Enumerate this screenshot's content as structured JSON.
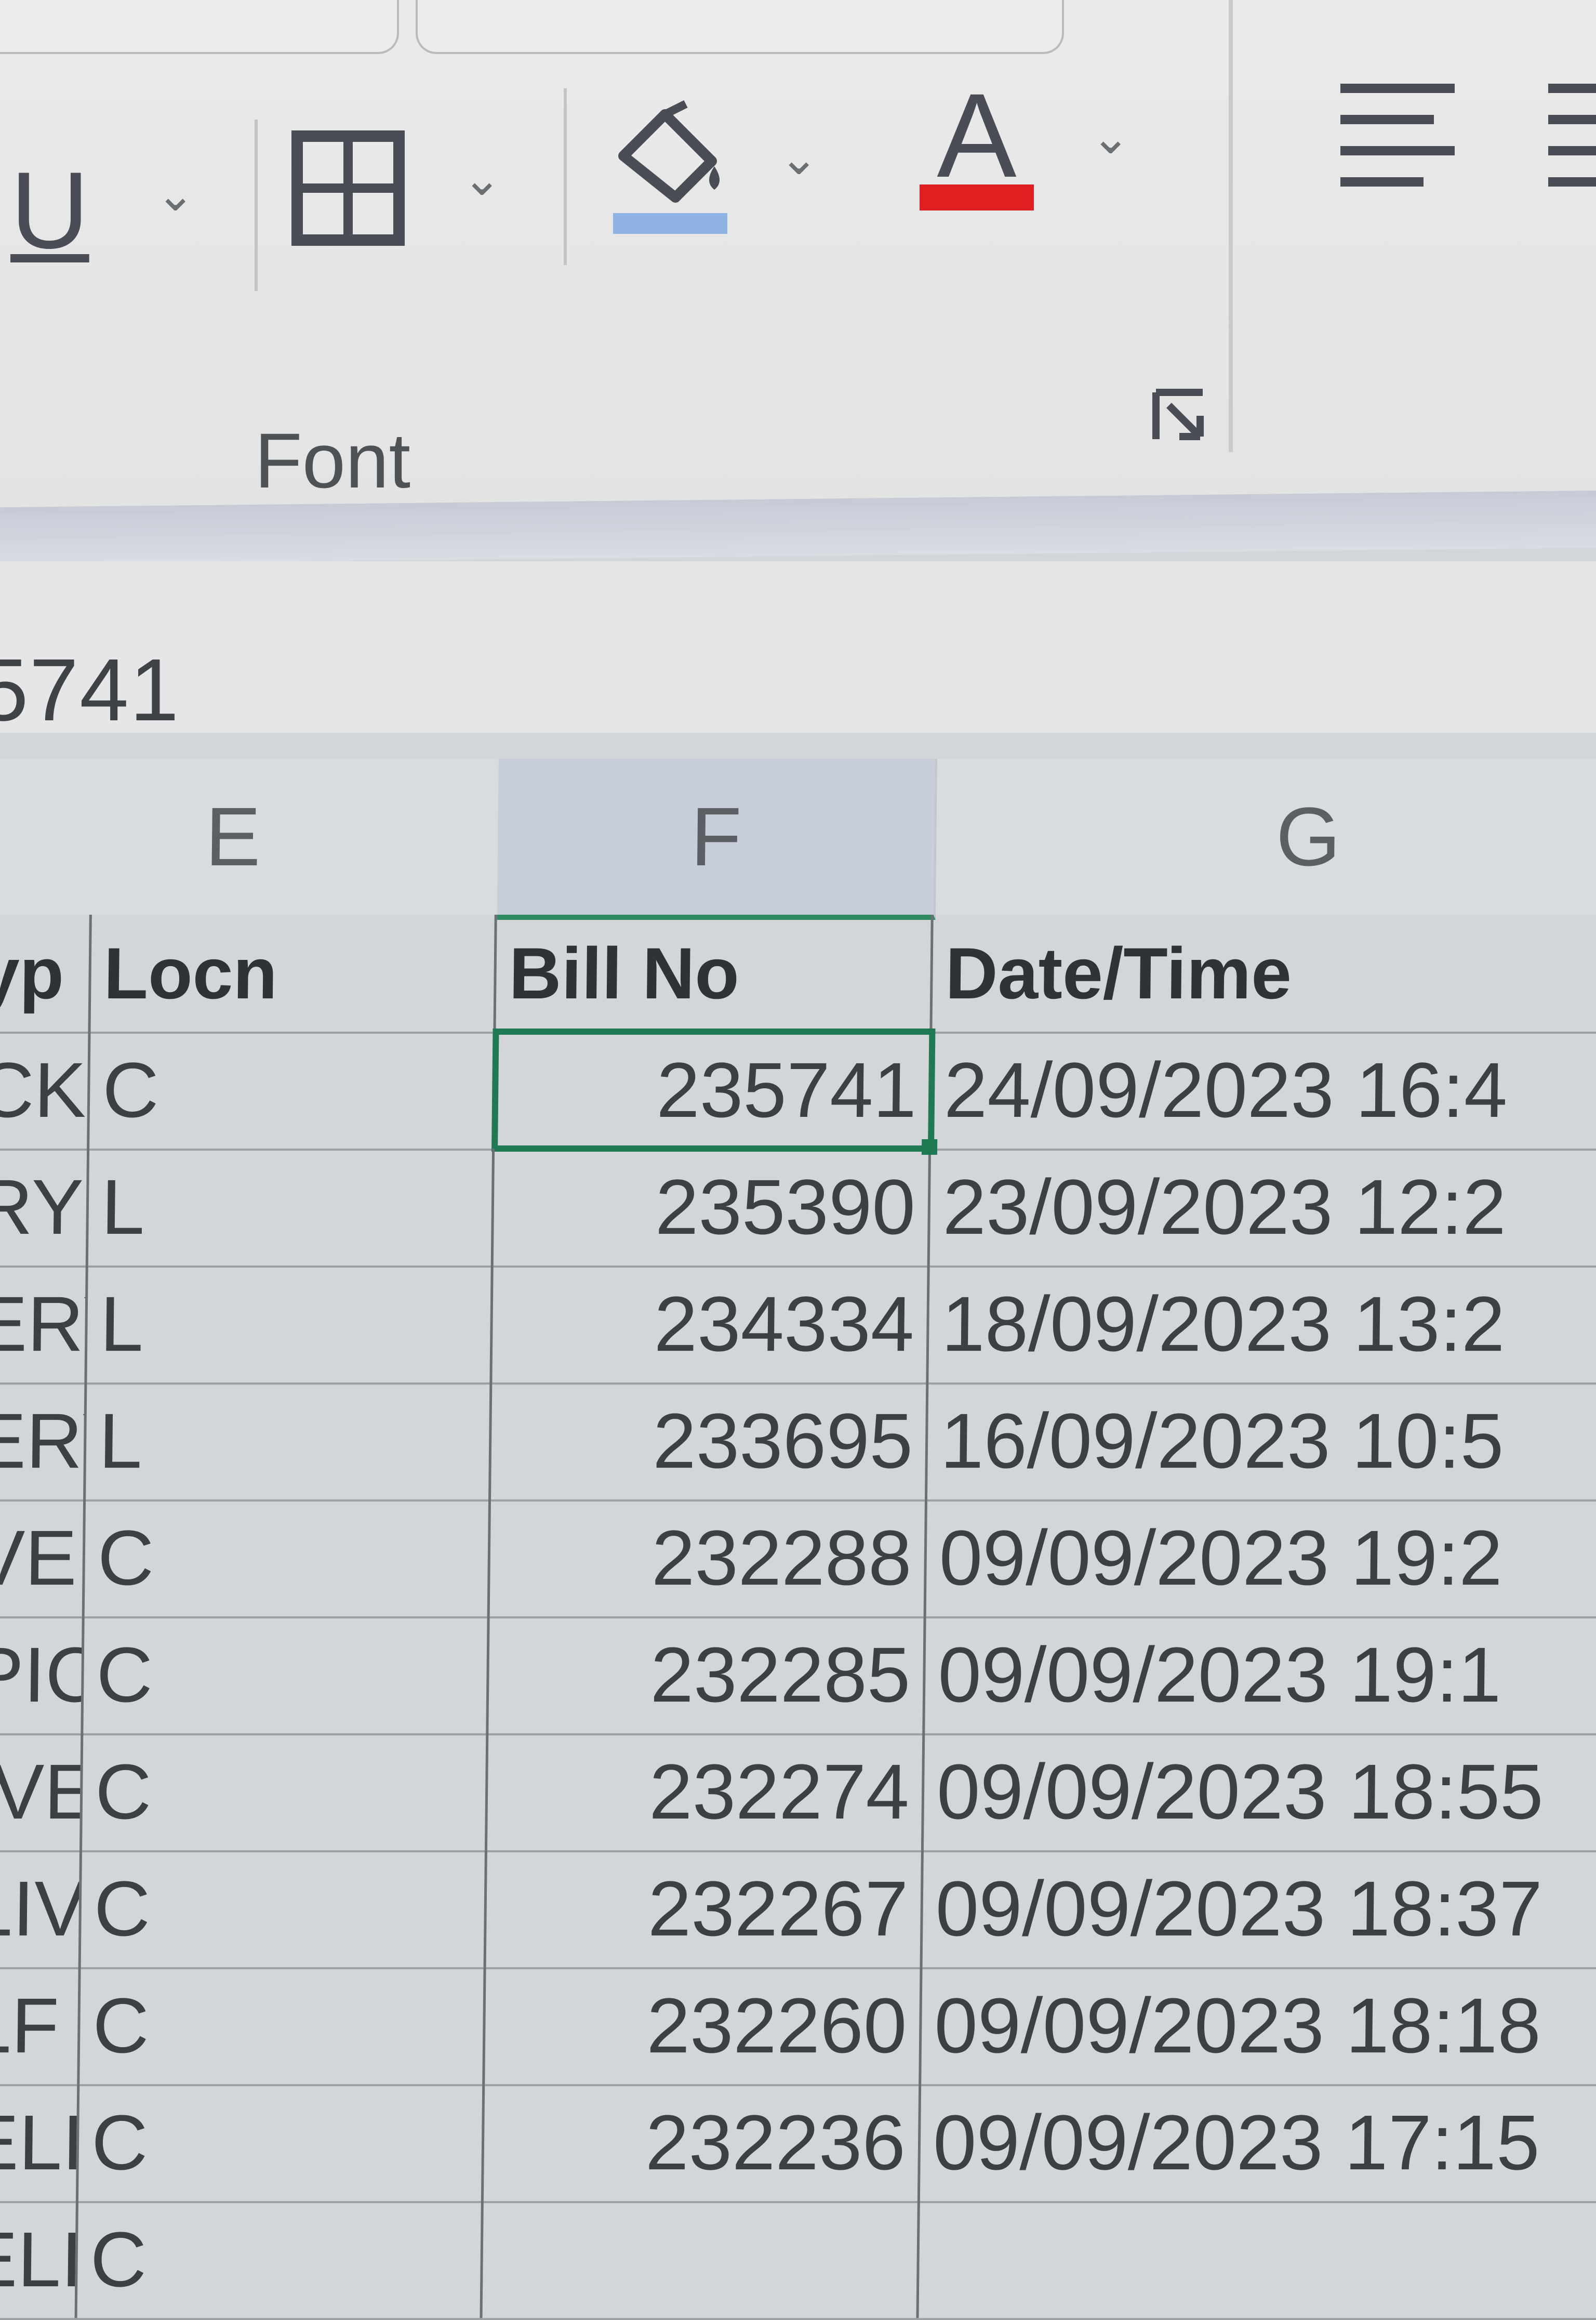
{
  "ribbon": {
    "font_group_label": "Font",
    "buttons": {
      "underline": "U",
      "font_color": "A"
    },
    "colors": {
      "fill_color": "#8fb4e3",
      "font_color": "#e02020",
      "selection": "#1f7a54"
    }
  },
  "formula_bar": {
    "value": "5741"
  },
  "column_headers": [
    "E",
    "F",
    "G"
  ],
  "table": {
    "headers": {
      "type": "yp",
      "locn": "Locn",
      "bill_no": "Bill No",
      "datetime": "Date/Time"
    },
    "rows": [
      {
        "type": "CKU",
        "locn": "C",
        "bill_no": "235741",
        "datetime": "24/09/2023 16:4"
      },
      {
        "type": "RY",
        "locn": "L",
        "bill_no": "235390",
        "datetime": "23/09/2023 12:2"
      },
      {
        "type": "ERY",
        "locn": "L",
        "bill_no": "234334",
        "datetime": "18/09/2023 13:2"
      },
      {
        "type": "ERY",
        "locn": "L",
        "bill_no": "233695",
        "datetime": "16/09/2023 10:5"
      },
      {
        "type": "VERY",
        "locn": "C",
        "bill_no": "232288",
        "datetime": "09/09/2023 19:2"
      },
      {
        "type": "PICKU",
        "locn": "C",
        "bill_no": "232285",
        "datetime": "09/09/2023 19:1"
      },
      {
        "type": "IVERY",
        "locn": "C",
        "bill_no": "232274",
        "datetime": "09/09/2023 18:55"
      },
      {
        "type": "LIVERY",
        "locn": "C",
        "bill_no": "232267",
        "datetime": "09/09/2023 18:37"
      },
      {
        "type": "LF PICKU",
        "locn": "C",
        "bill_no": "232260",
        "datetime": "09/09/2023 18:18"
      },
      {
        "type": "ELIVERY",
        "locn": "C",
        "bill_no": "232236",
        "datetime": "09/09/2023 17:15"
      },
      {
        "type": "ELIVERY",
        "locn": "C",
        "bill_no": "",
        "datetime": ""
      }
    ]
  }
}
